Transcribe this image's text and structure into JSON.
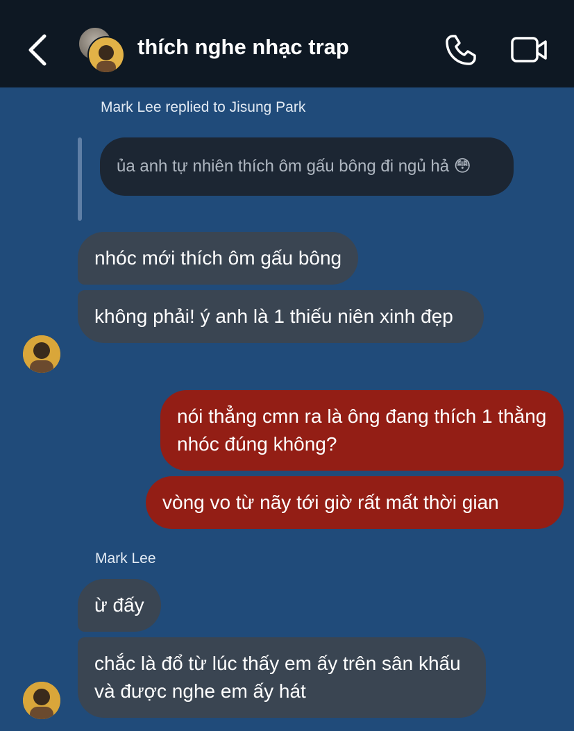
{
  "header": {
    "title": "thích nghe nhạc trap",
    "back_icon": "chevron-left-icon",
    "call_icon": "phone-icon",
    "video_icon": "video-camera-icon"
  },
  "reply": {
    "caption": "Mark Lee replied to Jisung Park",
    "quoted_text": "ủa anh tự nhiên thích ôm gấu bông đi ngủ hả 😳"
  },
  "messages": [
    {
      "direction": "incoming",
      "text": "nhóc mới thích ôm gấu bông"
    },
    {
      "direction": "incoming",
      "text": "không phải! ý anh là 1 thiếu niên xinh đẹp"
    },
    {
      "direction": "outgoing",
      "text": "nói thẳng cmn ra là ông đang thích 1 thằng nhóc đúng không?"
    },
    {
      "direction": "outgoing",
      "text": "vòng vo từ nãy tới giờ rất mất thời gian"
    },
    {
      "direction": "incoming",
      "sender": "Mark Lee",
      "text": "ừ đấy"
    },
    {
      "direction": "incoming",
      "text": "chắc là đổ từ lúc thấy em ấy trên sân khấu và được nghe em ấy hát"
    }
  ],
  "colors": {
    "background": "#204b7a",
    "header": "#0e1823",
    "incoming_bubble": "#3a4552",
    "outgoing_bubble": "#931e15",
    "quoted_bubble": "#1c2633"
  }
}
